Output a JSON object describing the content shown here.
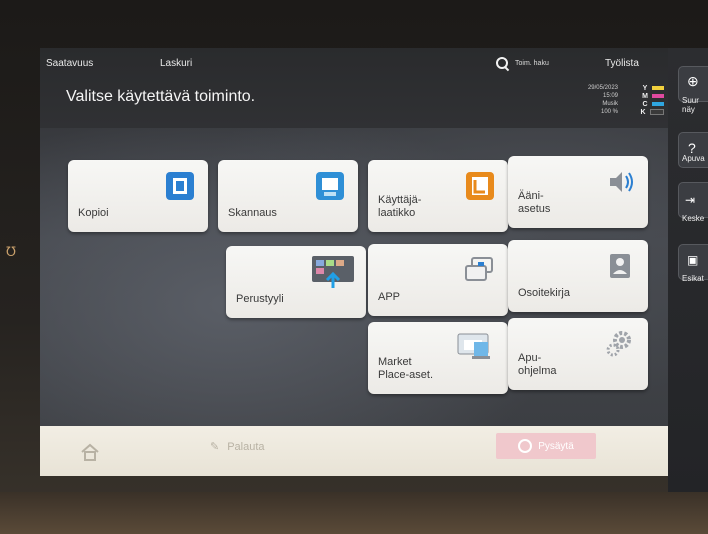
{
  "topbar": {
    "tab1": "Saatavuus",
    "tab2": "Laskuri",
    "search_label": "Toim. haku",
    "jobs": "Työlista"
  },
  "title": "Valitse käytettävä toiminto.",
  "status": {
    "date": "29/05/2023",
    "time": "15:09",
    "mode": "Musik",
    "zoom": "100 %",
    "toner": [
      {
        "letter": "Y",
        "color": "#f2d13d"
      },
      {
        "letter": "M",
        "color": "#e04aa0"
      },
      {
        "letter": "C",
        "color": "#2fa6e0"
      },
      {
        "letter": "K",
        "color": "#3a3a3a"
      }
    ]
  },
  "tiles": [
    {
      "label": "Kopioi",
      "icon": "copy-icon"
    },
    {
      "label": "Skannaus",
      "icon": "scan-icon"
    },
    {
      "label": "Käyttäjä-\nlaatikko",
      "icon": "user-box-icon"
    },
    {
      "label": "Ääni-\nasetus",
      "icon": "speaker-icon"
    },
    {
      "label": "Perustyyli",
      "icon": "basic-style-icon"
    },
    {
      "label": "APP",
      "icon": "app-icon"
    },
    {
      "label": "Osoitekirja",
      "icon": "address-book-icon"
    },
    {
      "label": "Market\nPlace-aset.",
      "icon": "marketplace-icon"
    },
    {
      "label": "Apu-\nohjelma",
      "icon": "gear-icon"
    }
  ],
  "footer": {
    "reset_label": "Palauta",
    "stop_label": "Pysäytä"
  },
  "sidebar": {
    "items": [
      {
        "label": "Suur\nnäy"
      },
      {
        "label": "Apuva"
      },
      {
        "label": "Keske"
      },
      {
        "label": "Esikat"
      }
    ]
  }
}
